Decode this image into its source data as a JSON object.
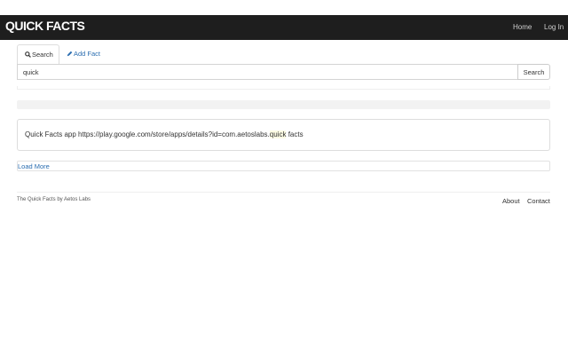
{
  "navbar": {
    "brand": "QUICK FACTS",
    "links": [
      "Home",
      "Log In"
    ]
  },
  "tabs": {
    "search": "Search",
    "add_fact": "Add Fact"
  },
  "search": {
    "query": "quick",
    "button_label": "Search"
  },
  "results": [
    {
      "before": "Quick Facts app https://play.google.com/store/apps/details?id=com.aetoslabs.",
      "highlight": "quick",
      "after": " facts"
    }
  ],
  "load_more_label": "Load More",
  "footer": {
    "credit": "The Quick Facts by Aetos Labs",
    "links": [
      "About",
      "Contact"
    ]
  },
  "colors": {
    "navbar_bg": "#1e1e1e",
    "link": "#2a6db0",
    "highlight_bg": "#fcfbe3"
  }
}
